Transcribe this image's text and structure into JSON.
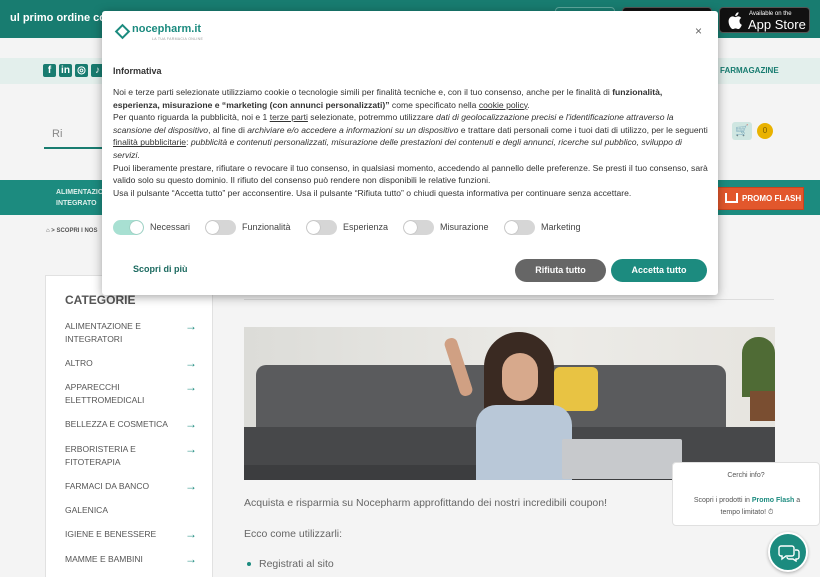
{
  "topbar": {
    "promo_text": "ul primo ordine con il d",
    "appstore_small": "Available on the",
    "appstore_big": "App Store"
  },
  "social": {
    "icons": [
      "facebook-icon",
      "linkedin-icon",
      "instagram-icon",
      "tiktok-icon"
    ],
    "farmagazine": "FARMAGAZINE"
  },
  "search": {
    "value": "Ri"
  },
  "cart": {
    "count": "0"
  },
  "nav": {
    "category_label": "ALIMENTAZIO E INTEGRATO",
    "flash_label": "PROMO FLASH"
  },
  "breadcrumb": "> SCOPRI I NOS",
  "sidebar": {
    "heading": "CATEGORIE",
    "items": [
      "ALIMENTAZIONE E INTEGRATORI",
      "ALTRO",
      "APPARECCHI ELETTROMEDICALI",
      "BELLEZZA E COSMETICA",
      "ERBORISTERIA E FITOTERAPIA",
      "FARMACI DA BANCO",
      "GALENICA",
      "IGIENE E BENESSERE",
      "MAMME E BAMBINI"
    ]
  },
  "content": {
    "p1": "Acquista e risparmia su Nocepharm approfittando dei nostri incredibili coupon!",
    "p2": "Ecco come utilizzarli:",
    "li1": "Registrati al sito"
  },
  "help": {
    "question": "Cerchi info?",
    "text_before": "Scopri i prodotti in",
    "text_highlight": "Promo Flash",
    "text_after": "a tempo limitato! ⏱"
  },
  "dialog": {
    "logo_brand": "nocepharm.it",
    "logo_tag": "LA TUA FARMACIA ONLINE",
    "close": "×",
    "title": "Informativa",
    "body": [
      {
        "t": "Noi e terze parti selezionate utilizziamo cookie o tecnologie simili per finalità tecniche e, con il tuo consenso, anche per le finalità di "
      },
      {
        "b": "funzionalità, esperienza, misurazione e “marketing (con annunci personalizzati)”"
      },
      {
        "t": " come specificato nella "
      },
      {
        "a": "cookie policy"
      },
      {
        "t": "."
      },
      {
        "br": 1
      },
      {
        "t": "Per quanto riguarda la pubblicità, noi e 1 "
      },
      {
        "a": "terze parti"
      },
      {
        "t": " selezionate, potremmo utilizzare "
      },
      {
        "i": "dati di geolocalizzazione precisi e l'identificazione attraverso la scansione del dispositivo"
      },
      {
        "t": ", al fine di "
      },
      {
        "i": "archiviare e/o accedere a informazioni su un dispositivo"
      },
      {
        "t": " e trattare dati personali come i tuoi dati di utilizzo, per le seguenti "
      },
      {
        "a": "finalità pubblicitarie"
      },
      {
        "t": ": "
      },
      {
        "i": "pubblicità e contenuti personalizzati, misurazione delle prestazioni dei contenuti e degli annunci, ricerche sul pubblico, sviluppo di servizi"
      },
      {
        "t": "."
      },
      {
        "br": 1
      },
      {
        "t": "Puoi liberamente prestare, rifiutare o revocare il tuo consenso, in qualsiasi momento, accedendo al pannello delle preferenze. Se presti il tuo consenso, sarà valido solo su questo dominio. Il rifiuto del consenso può rendere non disponibili le relative funzioni."
      },
      {
        "br": 1
      },
      {
        "t": "Usa il pulsante “Accetta tutto” per acconsentire. Usa il pulsante “Rifiuta tutto” o chiudi questa informativa per continuare senza accettare."
      }
    ],
    "toggles": [
      {
        "label": "Necessari",
        "on": true
      },
      {
        "label": "Funzionalità",
        "on": false
      },
      {
        "label": "Esperienza",
        "on": false
      },
      {
        "label": "Misurazione",
        "on": false
      },
      {
        "label": "Marketing",
        "on": false
      }
    ],
    "learn_more": "Scopri di più",
    "reject": "Rifiuta tutto",
    "accept": "Accetta tutto"
  }
}
